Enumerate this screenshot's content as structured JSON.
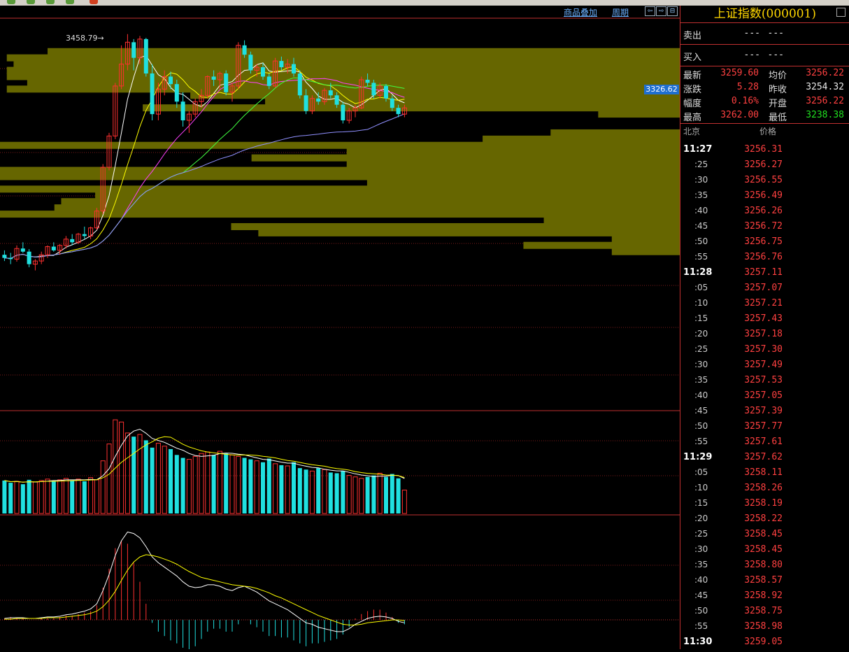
{
  "toolbar": {
    "overlay_link": "商品叠加",
    "period_link": "周期"
  },
  "chart": {
    "current_price_label": "3326.62",
    "peak_label": "3458.79"
  },
  "quote_panel": {
    "title": "上证指数(000001)",
    "sell_label": "卖出",
    "buy_label": "买入",
    "sell_val1": "---",
    "sell_val2": "---",
    "buy_val1": "---",
    "buy_val2": "---",
    "rows": [
      {
        "l1": "最新",
        "v1": "3259.60",
        "c1": "red",
        "l2": "均价",
        "v2": "3256.22",
        "c2": "red"
      },
      {
        "l1": "涨跌",
        "v1": "5.28",
        "c1": "red",
        "l2": "昨收",
        "v2": "3254.32",
        "c2": "white"
      },
      {
        "l1": "幅度",
        "v1": "0.16%",
        "c1": "red",
        "l2": "开盘",
        "v2": "3256.22",
        "c2": "red"
      },
      {
        "l1": "最高",
        "v1": "3262.00",
        "c1": "red",
        "l2": "最低",
        "v2": "3238.38",
        "c2": "green"
      }
    ],
    "tick_header_time": "北京",
    "tick_header_price": "价格",
    "ticks": [
      {
        "t": "11:27",
        "p": "3256.31"
      },
      {
        "t": ":25",
        "p": "3256.27"
      },
      {
        "t": ":30",
        "p": "3256.55"
      },
      {
        "t": ":35",
        "p": "3256.49"
      },
      {
        "t": ":40",
        "p": "3256.26"
      },
      {
        "t": ":45",
        "p": "3256.72"
      },
      {
        "t": ":50",
        "p": "3256.75"
      },
      {
        "t": ":55",
        "p": "3256.76"
      },
      {
        "t": "11:28",
        "p": "3257.11"
      },
      {
        "t": ":05",
        "p": "3257.07"
      },
      {
        "t": ":10",
        "p": "3257.21"
      },
      {
        "t": ":15",
        "p": "3257.43"
      },
      {
        "t": ":20",
        "p": "3257.18"
      },
      {
        "t": ":25",
        "p": "3257.30"
      },
      {
        "t": ":30",
        "p": "3257.49"
      },
      {
        "t": ":35",
        "p": "3257.53"
      },
      {
        "t": ":40",
        "p": "3257.05"
      },
      {
        "t": ":45",
        "p": "3257.39"
      },
      {
        "t": ":50",
        "p": "3257.77"
      },
      {
        "t": ":55",
        "p": "3257.61"
      },
      {
        "t": "11:29",
        "p": "3257.62"
      },
      {
        "t": ":05",
        "p": "3258.11"
      },
      {
        "t": ":10",
        "p": "3258.26"
      },
      {
        "t": ":15",
        "p": "3258.19"
      },
      {
        "t": ":20",
        "p": "3258.22"
      },
      {
        "t": ":25",
        "p": "3258.45"
      },
      {
        "t": ":30",
        "p": "3258.45"
      },
      {
        "t": ":35",
        "p": "3258.80"
      },
      {
        "t": ":40",
        "p": "3258.57"
      },
      {
        "t": ":45",
        "p": "3258.92"
      },
      {
        "t": ":50",
        "p": "3258.75"
      },
      {
        "t": ":55",
        "p": "3258.98"
      },
      {
        "t": "11:30",
        "p": "3259.05"
      }
    ]
  },
  "chart_data": {
    "type": "candlestick",
    "price_range": [
      3000,
      3470
    ],
    "candles": [
      [
        3105,
        3112,
        3095,
        3100
      ],
      [
        3100,
        3108,
        3090,
        3098
      ],
      [
        3098,
        3120,
        3094,
        3115
      ],
      [
        3115,
        3125,
        3108,
        3110
      ],
      [
        3110,
        3114,
        3085,
        3090
      ],
      [
        3090,
        3098,
        3080,
        3095
      ],
      [
        3095,
        3110,
        3090,
        3105
      ],
      [
        3105,
        3120,
        3100,
        3118
      ],
      [
        3118,
        3125,
        3110,
        3112
      ],
      [
        3112,
        3122,
        3105,
        3120
      ],
      [
        3120,
        3135,
        3115,
        3130
      ],
      [
        3130,
        3138,
        3120,
        3125
      ],
      [
        3125,
        3140,
        3122,
        3138
      ],
      [
        3138,
        3150,
        3130,
        3135
      ],
      [
        3135,
        3150,
        3130,
        3148
      ],
      [
        3148,
        3180,
        3145,
        3175
      ],
      [
        3175,
        3250,
        3170,
        3245
      ],
      [
        3245,
        3300,
        3240,
        3295
      ],
      [
        3295,
        3380,
        3290,
        3375
      ],
      [
        3375,
        3440,
        3370,
        3410
      ],
      [
        3410,
        3458,
        3400,
        3445
      ],
      [
        3445,
        3450,
        3400,
        3420
      ],
      [
        3420,
        3455,
        3410,
        3450
      ],
      [
        3450,
        3452,
        3390,
        3395
      ],
      [
        3395,
        3410,
        3320,
        3330
      ],
      [
        3330,
        3380,
        3320,
        3370
      ],
      [
        3370,
        3400,
        3360,
        3390
      ],
      [
        3390,
        3398,
        3370,
        3378
      ],
      [
        3378,
        3385,
        3340,
        3350
      ],
      [
        3350,
        3365,
        3310,
        3320
      ],
      [
        3320,
        3335,
        3300,
        3330
      ],
      [
        3330,
        3355,
        3325,
        3350
      ],
      [
        3350,
        3370,
        3340,
        3360
      ],
      [
        3360,
        3392,
        3355,
        3390
      ],
      [
        3390,
        3400,
        3375,
        3385
      ],
      [
        3385,
        3398,
        3370,
        3395
      ],
      [
        3395,
        3400,
        3360,
        3365
      ],
      [
        3365,
        3380,
        3350,
        3375
      ],
      [
        3375,
        3445,
        3370,
        3440
      ],
      [
        3440,
        3448,
        3420,
        3425
      ],
      [
        3425,
        3430,
        3395,
        3400
      ],
      [
        3400,
        3410,
        3390,
        3405
      ],
      [
        3405,
        3412,
        3385,
        3390
      ],
      [
        3390,
        3395,
        3370,
        3375
      ],
      [
        3375,
        3420,
        3372,
        3415
      ],
      [
        3415,
        3422,
        3400,
        3405
      ],
      [
        3405,
        3418,
        3395,
        3410
      ],
      [
        3410,
        3420,
        3390,
        3395
      ],
      [
        3395,
        3400,
        3355,
        3360
      ],
      [
        3360,
        3370,
        3330,
        3335
      ],
      [
        3335,
        3360,
        3330,
        3355
      ],
      [
        3355,
        3365,
        3345,
        3350
      ],
      [
        3350,
        3372,
        3345,
        3368
      ],
      [
        3368,
        3380,
        3355,
        3360
      ],
      [
        3360,
        3365,
        3340,
        3345
      ],
      [
        3345,
        3350,
        3315,
        3320
      ],
      [
        3320,
        3340,
        3315,
        3335
      ],
      [
        3335,
        3345,
        3325,
        3340
      ],
      [
        3340,
        3390,
        3338,
        3385
      ],
      [
        3385,
        3395,
        3375,
        3380
      ],
      [
        3380,
        3385,
        3355,
        3360
      ],
      [
        3360,
        3380,
        3355,
        3375
      ],
      [
        3375,
        3378,
        3350,
        3355
      ],
      [
        3355,
        3360,
        3335,
        3340
      ],
      [
        3340,
        3345,
        3325,
        3330
      ],
      [
        3330,
        3345,
        3325,
        3340
      ]
    ],
    "volume_range": [
      0,
      130
    ],
    "volumes": [
      45,
      42,
      44,
      40,
      46,
      43,
      45,
      47,
      44,
      46,
      48,
      45,
      47,
      44,
      49,
      46,
      72,
      95,
      128,
      125,
      110,
      105,
      108,
      100,
      90,
      96,
      92,
      88,
      80,
      76,
      74,
      78,
      82,
      84,
      80,
      85,
      82,
      80,
      78,
      76,
      74,
      72,
      70,
      75,
      68,
      66,
      65,
      70,
      62,
      60,
      58,
      62,
      60,
      56,
      55,
      58,
      52,
      50,
      48,
      50,
      52,
      55,
      50,
      54,
      48,
      32
    ],
    "macd_range": [
      -40,
      130
    ],
    "macd": [
      {
        "dif": 2,
        "dea": 1
      },
      {
        "dif": 3,
        "dea": 1
      },
      {
        "dif": 3,
        "dea": 2
      },
      {
        "dif": 3,
        "dea": 2
      },
      {
        "dif": 2,
        "dea": 2
      },
      {
        "dif": 2,
        "dea": 2
      },
      {
        "dif": 3,
        "dea": 2
      },
      {
        "dif": 4,
        "dea": 3
      },
      {
        "dif": 4,
        "dea": 3
      },
      {
        "dif": 5,
        "dea": 3
      },
      {
        "dif": 7,
        "dea": 4
      },
      {
        "dif": 8,
        "dea": 5
      },
      {
        "dif": 10,
        "dea": 6
      },
      {
        "dif": 12,
        "dea": 7
      },
      {
        "dif": 15,
        "dea": 9
      },
      {
        "dif": 22,
        "dea": 12
      },
      {
        "dif": 40,
        "dea": 18
      },
      {
        "dif": 62,
        "dea": 27
      },
      {
        "dif": 88,
        "dea": 39
      },
      {
        "dif": 108,
        "dea": 54
      },
      {
        "dif": 120,
        "dea": 68
      },
      {
        "dif": 118,
        "dea": 79
      },
      {
        "dif": 112,
        "dea": 86
      },
      {
        "dif": 100,
        "dea": 89
      },
      {
        "dif": 86,
        "dea": 88
      },
      {
        "dif": 78,
        "dea": 86
      },
      {
        "dif": 72,
        "dea": 83
      },
      {
        "dif": 66,
        "dea": 80
      },
      {
        "dif": 60,
        "dea": 76
      },
      {
        "dif": 52,
        "dea": 71
      },
      {
        "dif": 46,
        "dea": 66
      },
      {
        "dif": 44,
        "dea": 62
      },
      {
        "dif": 45,
        "dea": 58
      },
      {
        "dif": 48,
        "dea": 56
      },
      {
        "dif": 48,
        "dea": 54
      },
      {
        "dif": 46,
        "dea": 52
      },
      {
        "dif": 42,
        "dea": 50
      },
      {
        "dif": 40,
        "dea": 48
      },
      {
        "dif": 44,
        "dea": 47
      },
      {
        "dif": 46,
        "dea": 46
      },
      {
        "dif": 42,
        "dea": 45
      },
      {
        "dif": 38,
        "dea": 43
      },
      {
        "dif": 32,
        "dea": 40
      },
      {
        "dif": 26,
        "dea": 37
      },
      {
        "dif": 22,
        "dea": 33
      },
      {
        "dif": 18,
        "dea": 30
      },
      {
        "dif": 14,
        "dea": 26
      },
      {
        "dif": 8,
        "dea": 22
      },
      {
        "dif": 2,
        "dea": 18
      },
      {
        "dif": -4,
        "dea": 14
      },
      {
        "dif": -6,
        "dea": 10
      },
      {
        "dif": -10,
        "dea": 6
      },
      {
        "dif": -12,
        "dea": 3
      },
      {
        "dif": -14,
        "dea": 0
      },
      {
        "dif": -16,
        "dea": -3
      },
      {
        "dif": -16,
        "dea": -6
      },
      {
        "dif": -12,
        "dea": -7
      },
      {
        "dif": -6,
        "dea": -7
      },
      {
        "dif": -2,
        "dea": -6
      },
      {
        "dif": 2,
        "dea": -4
      },
      {
        "dif": 4,
        "dea": -3
      },
      {
        "dif": 5,
        "dea": -2
      },
      {
        "dif": 4,
        "dea": -1
      },
      {
        "dif": 2,
        "dea": 0
      },
      {
        "dif": -2,
        "dea": 0
      },
      {
        "dif": -4,
        "dea": -1
      }
    ],
    "volume_profile": [
      {
        "price": 3430,
        "len": 0.93
      },
      {
        "price": 3420,
        "len": 0.99
      },
      {
        "price": 3410,
        "len": 0.98
      },
      {
        "price": 3400,
        "len": 0.99
      },
      {
        "price": 3390,
        "len": 0.99
      },
      {
        "price": 3380,
        "len": 0.96
      },
      {
        "price": 3370,
        "len": 0.99
      },
      {
        "price": 3360,
        "len": 0.72
      },
      {
        "price": 3350,
        "len": 0.61
      },
      {
        "price": 3340,
        "len": 0.79
      },
      {
        "price": 3330,
        "len": 0.12
      },
      {
        "price": 3300,
        "len": 0.19
      },
      {
        "price": 3290,
        "len": 0.29
      },
      {
        "price": 3280,
        "len": 1.0
      },
      {
        "price": 3270,
        "len": 0.49
      },
      {
        "price": 3260,
        "len": 0.63
      },
      {
        "price": 3250,
        "len": 0.49
      },
      {
        "price": 3240,
        "len": 1.0
      },
      {
        "price": 3230,
        "len": 1.0
      },
      {
        "price": 3220,
        "len": 0.46
      },
      {
        "price": 3210,
        "len": 1.0
      },
      {
        "price": 3200,
        "len": 0.86
      },
      {
        "price": 3190,
        "len": 0.91
      },
      {
        "price": 3180,
        "len": 0.92
      },
      {
        "price": 3170,
        "len": 1.0
      },
      {
        "price": 3160,
        "len": 0.2
      },
      {
        "price": 3150,
        "len": 0.66
      },
      {
        "price": 3140,
        "len": 0.62
      },
      {
        "price": 3130,
        "len": 0.1
      },
      {
        "price": 3120,
        "len": 0.23
      },
      {
        "price": 3110,
        "len": 0.1
      }
    ]
  }
}
